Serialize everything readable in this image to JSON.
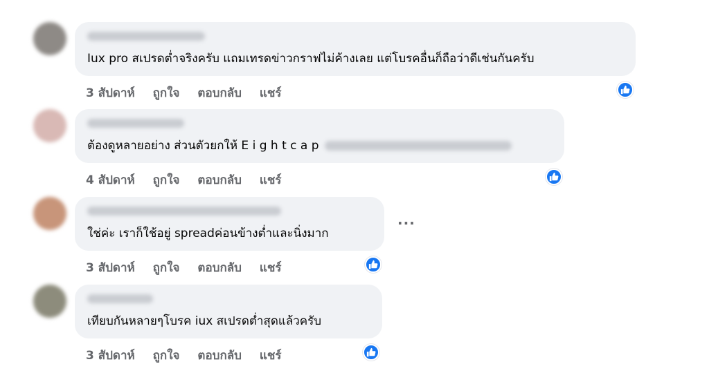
{
  "colors": {
    "bubble": "#f0f2f5",
    "like": "#1877f2",
    "meta": "#65676b"
  },
  "comments": [
    {
      "author": "",
      "text": "Iux pro สเปรดต่ำจริงครับ แถมเทรดข่าวกราฟไม่ค้างเลย แต่โบรคอื่นก็ถือว่าดีเช่นกันครับ",
      "time": "3 สัปดาห์",
      "like_label": "ถูกใจ",
      "reply_label": "ตอบกลับ",
      "share_label": "แชร์"
    },
    {
      "author": "",
      "text": "ต้องดูหลายอย่าง ส่วนตัวยกให้ E i g h t c a p",
      "time": "4 สัปดาห์",
      "like_label": "ถูกใจ",
      "reply_label": "ตอบกลับ",
      "share_label": "แชร์"
    },
    {
      "author": "",
      "text": "ใช่ค่ะ เราก็ใช้อยู่ spreadค่อนข้างต่ำและนิ่งมาก",
      "time": "3 สัปดาห์",
      "like_label": "ถูกใจ",
      "reply_label": "ตอบกลับ",
      "share_label": "แชร์",
      "more_icon": "···"
    },
    {
      "author": "",
      "text": "เทียบกันหลายๆโบรค iux สเปรดต่ำสุดแล้วครับ",
      "time": "3 สัปดาห์",
      "like_label": "ถูกใจ",
      "reply_label": "ตอบกลับ",
      "share_label": "แชร์"
    }
  ]
}
